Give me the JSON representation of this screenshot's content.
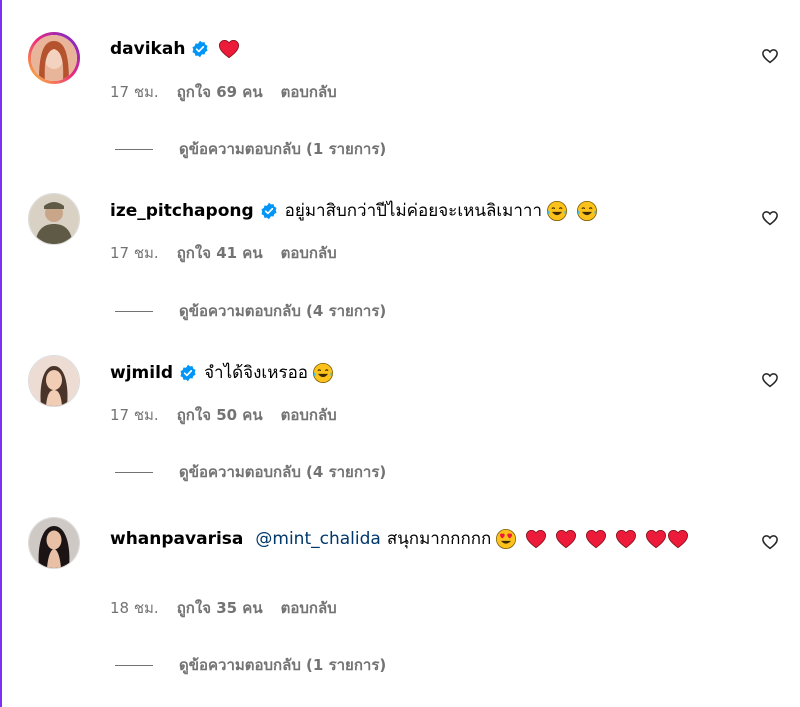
{
  "comments": [
    {
      "username": "davikah",
      "mention": "",
      "text": "",
      "emojis": [
        "heart"
      ],
      "time": "17 ชม.",
      "likes": "ถูกใจ 69 คน",
      "reply_label": "ตอบกลับ",
      "view_replies": "ดูข้อความตอบกลับ (1 รายการ)",
      "verified": true,
      "avatar_colors": [
        "#e8b59a",
        "#b5532f"
      ]
    },
    {
      "username": "ize_pitchapong",
      "mention": "",
      "text": "อยู่มาสิบกว่าปีไม่ค่อยจะเหนลิเมาาา",
      "emojis": [
        "joy",
        "joy"
      ],
      "time": "17 ชม.",
      "likes": "ถูกใจ 41 คน",
      "reply_label": "ตอบกลับ",
      "view_replies": "ดูข้อความตอบกลับ (4 รายการ)",
      "verified": true,
      "avatar_colors": [
        "#d9d2c4",
        "#5e5a45"
      ]
    },
    {
      "username": "wjmild",
      "mention": "",
      "text": "จำได้จิงเหรออ",
      "emojis": [
        "joy"
      ],
      "time": "17 ชม.",
      "likes": "ถูกใจ 50 คน",
      "reply_label": "ตอบกลับ",
      "view_replies": "ดูข้อความตอบกลับ (4 รายการ)",
      "verified": true,
      "avatar_colors": [
        "#ecdcd3",
        "#4a3429"
      ]
    },
    {
      "username": "whanpavarisa",
      "mention": "@mint_chalida",
      "text": "สนุกมากกกกก",
      "emojis": [
        "heart-eyes",
        "heart",
        "heart",
        "heart",
        "heart",
        "heart",
        "heart"
      ],
      "time": "18 ชม.",
      "likes": "ถูกใจ 35 คน",
      "reply_label": "ตอบกลับ",
      "view_replies": "ดูข้อความตอบกลับ (1 รายการ)",
      "verified": false,
      "avatar_colors": [
        "#cfc9c6",
        "#1c1414"
      ]
    }
  ],
  "icons": {
    "verified_badge": "verified-badge-icon",
    "like": "heart-outline-icon"
  },
  "colors": {
    "verified": "#0095f6",
    "heart": "#ed1b3a",
    "emoji_face": "#fcc21b",
    "tears": "#40c0e7",
    "secondary_text": "#737373",
    "mention": "#00376b"
  }
}
